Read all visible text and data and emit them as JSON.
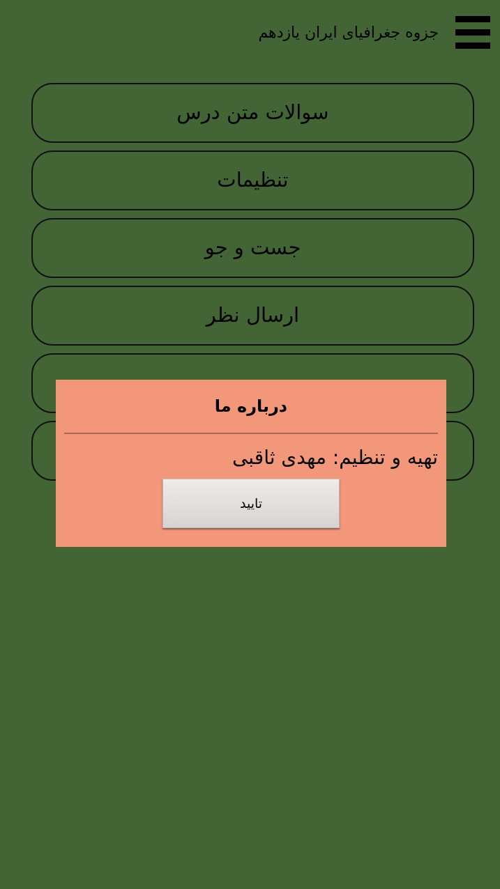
{
  "header": {
    "title": "جزوه جغرافیای ایران یازدهم"
  },
  "menu": [
    {
      "kind": "labeled",
      "label": "سوالات متن درس"
    },
    {
      "kind": "labeled",
      "label": "تنظیمات"
    },
    {
      "kind": "labeled",
      "label": "جست و جو"
    },
    {
      "kind": "labeled",
      "label": "ارسال نظر"
    },
    {
      "kind": "covered"
    },
    {
      "kind": "covered"
    }
  ],
  "dialog": {
    "title": "درباره ما",
    "message": "تهیه و تنظیم: مهدی ثاقبی",
    "button": "تایید"
  }
}
